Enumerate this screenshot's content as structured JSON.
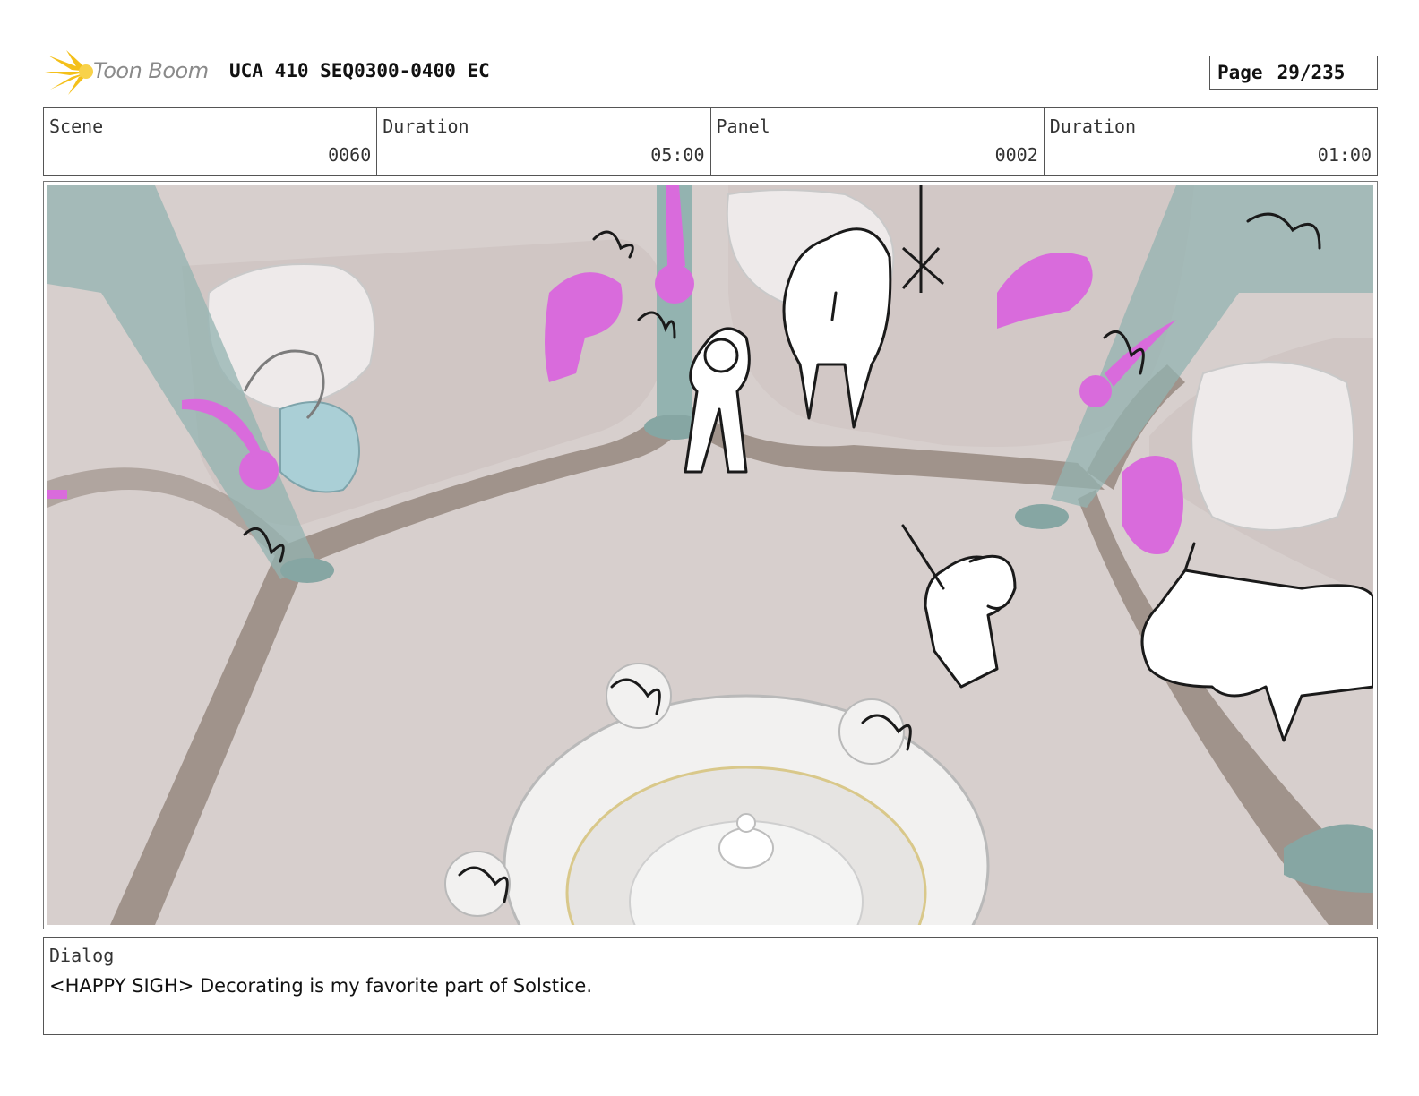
{
  "header": {
    "logo_text": "Toon Boom",
    "title": "UCA 410 SEQ0300-0400 EC",
    "page_label": "Page",
    "page_value": "29/235"
  },
  "meta": {
    "scene_label": "Scene",
    "scene_value": "0060",
    "scene_duration_label": "Duration",
    "scene_duration_value": "05:00",
    "panel_label": "Panel",
    "panel_value": "0002",
    "panel_duration_label": "Duration",
    "panel_duration_value": "01:00"
  },
  "dialog": {
    "label": "Dialog",
    "text": "<HAPPY SIGH> Decorating is my favorite part of Solstice."
  },
  "colors": {
    "floor": "#d7cfcd",
    "beam": "#a0938b",
    "teal": "#93b3b0",
    "magenta": "#d96bdc",
    "sketch": "#1a1a1a",
    "logo_yellow": "#f4c01a"
  }
}
